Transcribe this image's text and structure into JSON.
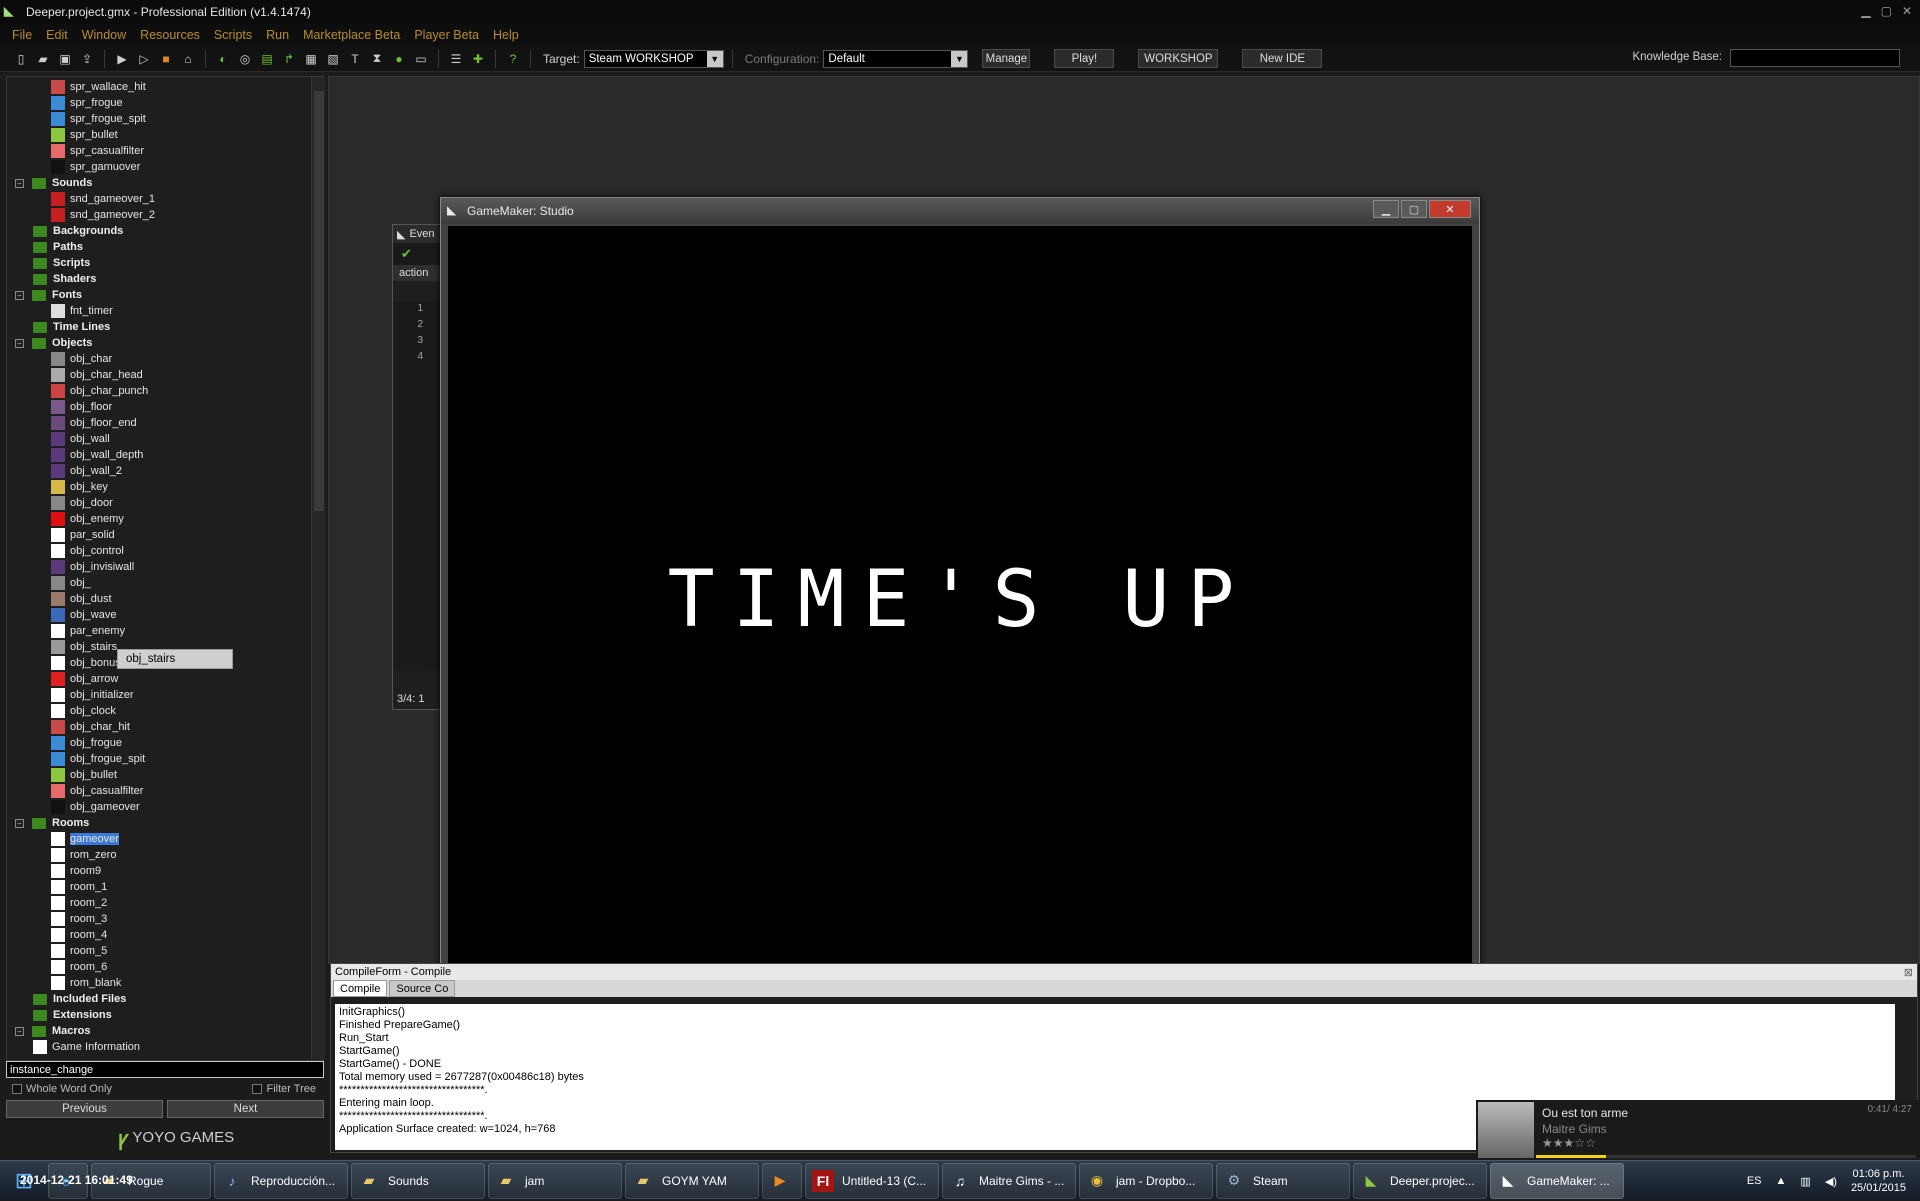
{
  "window": {
    "title": "Deeper.project.gmx  -  Professional Edition (v1.4.1474)"
  },
  "menu": [
    "File",
    "Edit",
    "Window",
    "Resources",
    "Scripts",
    "Run",
    "Marketplace Beta",
    "Player Beta",
    "Help"
  ],
  "toolbar": {
    "target_label": "Target:",
    "target_value": "Steam WORKSHOP",
    "config_label": "Configuration:",
    "config_value": "Default",
    "manage": "Manage",
    "play": "Play!",
    "workshop": "WORKSHOP",
    "new_ide": "New IDE",
    "kb_label": "Knowledge Base:"
  },
  "tree": {
    "sprites": [
      "spr_wallace_hit",
      "spr_frogue",
      "spr_frogue_spit",
      "spr_bullet",
      "spr_casualfilter",
      "spr_gamuover"
    ],
    "sounds_label": "Sounds",
    "sounds": [
      "snd_gameover_1",
      "snd_gameover_2"
    ],
    "backgrounds": "Backgrounds",
    "paths": "Paths",
    "scripts": "Scripts",
    "shaders": "Shaders",
    "fonts_label": "Fonts",
    "fonts": [
      "fnt_timer"
    ],
    "timelines": "Time Lines",
    "objects_label": "Objects",
    "objects": [
      "obj_char",
      "obj_char_head",
      "obj_char_punch",
      "obj_floor",
      "obj_floor_end",
      "obj_wall",
      "obj_wall_depth",
      "obj_wall_2",
      "obj_key",
      "obj_door",
      "obj_enemy",
      "par_solid",
      "obj_control",
      "obj_invisiwall",
      "obj_",
      "obj_dust",
      "obj_wave",
      "par_enemy",
      "obj_stairs",
      "obj_bonustime",
      "obj_arrow",
      "obj_initializer",
      "obj_clock",
      "obj_char_hit",
      "obj_frogue",
      "obj_frogue_spit",
      "obj_bullet",
      "obj_casualfilter",
      "obj_gameover"
    ],
    "rooms_label": "Rooms",
    "rooms": [
      "gameover",
      "rom_zero",
      "room9",
      "room_1",
      "room_2",
      "room_3",
      "room_4",
      "room_5",
      "room_6",
      "rom_blank"
    ],
    "included_files": "Included Files",
    "extensions": "Extensions",
    "macros": "Macros",
    "game_information": "Game Information",
    "tooltip": "obj_stairs"
  },
  "search": {
    "value": "instance_change",
    "whole_word": "Whole Word Only",
    "filter_tree": "Filter Tree",
    "previous": "Previous",
    "next": "Next",
    "logo_text": "YOYO GAMES"
  },
  "event_window": {
    "title": "Even",
    "tab": "action",
    "lines": [
      "1",
      "2",
      "3",
      "4"
    ],
    "status": "3/4: 1"
  },
  "game_window": {
    "title": "GameMaker: Studio",
    "text": "TIME'S UP"
  },
  "compile": {
    "header": "CompileForm - Compile",
    "tabs": [
      "Compile",
      "Source Co"
    ],
    "lines": [
      "InitGraphics()",
      "Finished PrepareGame()",
      "Run_Start",
      "StartGame()",
      "StartGame() - DONE",
      "Total memory used = 2677287(0x00486c18) bytes",
      "**********************************.",
      "Entering main loop.",
      "**********************************.",
      "Application Surface created: w=1024, h=768"
    ]
  },
  "music": {
    "title": "Ou est ton arme",
    "artist": "Maitre Gims",
    "time": "0:41/ 4:27"
  },
  "taskbar": {
    "items": [
      "Rogue",
      "Reproducción...",
      "Sounds",
      "jam",
      "GOYM YAM",
      "",
      "Untitled-13 (C...",
      "Maitre Gims - ...",
      "jam - Dropbo...",
      "Steam",
      "Deeper.projec...",
      "GameMaker: ..."
    ],
    "lang": "ES",
    "time": "01:06 p.m.",
    "date": "25/01/2015",
    "overlay": "2014-12-21 16:01:49"
  }
}
